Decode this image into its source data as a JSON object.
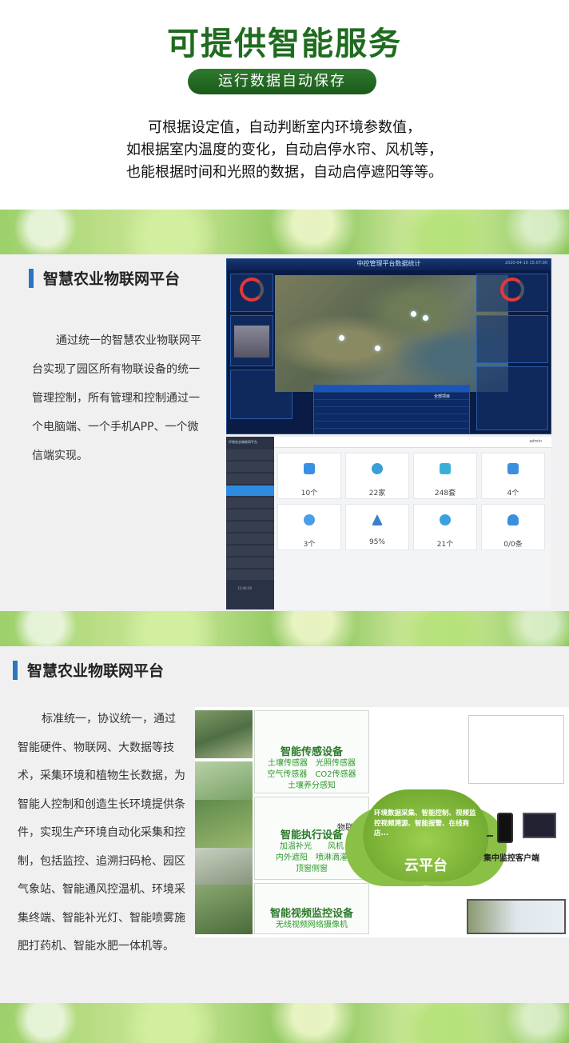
{
  "hero": {
    "title": "可提供智能服务",
    "pill": "运行数据自动保存",
    "lines": [
      "可根据设定值，自动判断室内环境参数值，",
      "如根据室内温度的变化，自动启停水帘、风机等，",
      "也能根据时间和光照的数据，自动启停遮阳等等。"
    ]
  },
  "section1": {
    "heading": "智慧农业物联网平台",
    "paragraph": "通过统一的智慧农业物联网平台实现了园区所有物联设备的统一管理控制，所有管理和控制通过一个电脑端、一个手机APP、一个微信端实现。",
    "dashboard": {
      "title": "中控管理平台数据统计",
      "time": "2020-04-10 15:07:00",
      "table_header": "全部项目"
    },
    "admin": {
      "app_name": "环境农业物联网平台",
      "user": "admin",
      "cards": [
        {
          "value": "10个",
          "color": "#3a8fe0"
        },
        {
          "value": "22家",
          "color": "#3a9fd8"
        },
        {
          "value": "248套",
          "color": "#3ab0d8"
        },
        {
          "value": "4个",
          "color": "#3a8fe0"
        },
        {
          "value": "3个",
          "color": "#4a9de8"
        },
        {
          "value": "95%",
          "color": "#3a7fd0"
        },
        {
          "value": "21个",
          "color": "#3aa0e0"
        },
        {
          "value": "0/0条",
          "color": "#3a8fe0"
        }
      ],
      "footer_time": "15:08:58"
    }
  },
  "section2": {
    "heading": "智慧农业物联网平台",
    "paragraph": "标准统一，协议统一，通过智能硬件、物联网、大数据等技术，采集环境和植物生长数据，为智能人控制和创造生长环境提供条件，实现生产环境自动化采集和控制，包括监控、追溯扫码枪、园区气象站、智能通风控温机、环境采集终端、智能补光灯、智能喷雾施肥打药机、智能水肥一体机等。",
    "diagram": {
      "sensor": {
        "title": "智能传感设备",
        "items": [
          "土壤传感器",
          "光照传感器",
          "空气传感器",
          "CO2传感器",
          "土壤养分感知"
        ]
      },
      "actuator": {
        "title": "智能执行设备",
        "items": [
          "加温补光",
          "风机",
          "内外遮阳",
          "喷淋滴灌",
          "顶窗侧窗"
        ]
      },
      "video": {
        "title": "智能视频监控设备",
        "items": [
          "无线视频网络摄像机"
        ]
      },
      "iot_label": "物联网",
      "cloud_text": "环境数据采集、智能控制、视频监控视频溯源、智能报警、在线商店...",
      "cloud_name": "云平台",
      "client": "集中监控客户端"
    }
  }
}
